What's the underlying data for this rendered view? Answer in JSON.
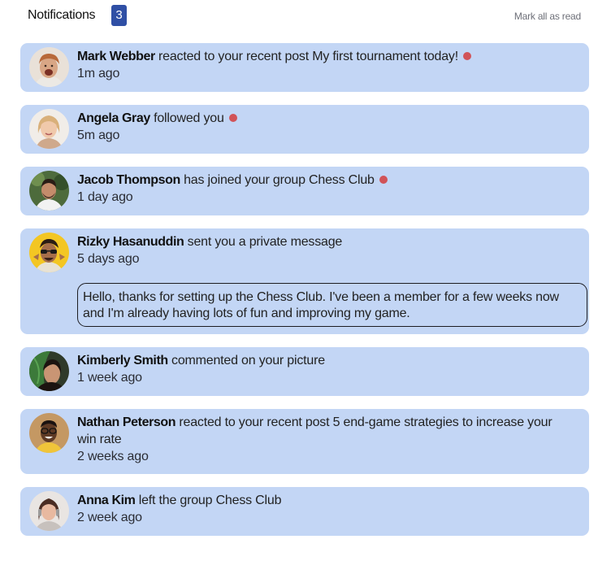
{
  "header": {
    "title": "Notifications",
    "count": "3",
    "mark_all": "Mark all as read"
  },
  "colors": {
    "card_background": "#c3d6f5",
    "unread_dot": "#d15358",
    "badge": "#2f4fa5"
  },
  "notifications": [
    {
      "name": "Mark Webber",
      "action": "reacted to your recent post My first tournament today!",
      "time": "1m ago",
      "unread": true
    },
    {
      "name": "Angela Gray",
      "action": "followed you",
      "time": "5m ago",
      "unread": true
    },
    {
      "name": "Jacob Thompson",
      "action": "has joined your group Chess Club",
      "time": "1 day ago",
      "unread": true
    },
    {
      "name": "Rizky Hasanuddin",
      "action": "sent you a private message",
      "time": "5 days ago",
      "unread": false,
      "message": "Hello, thanks for setting up the Chess Club. I've been a member for a few weeks now and I'm already having lots of fun and improving my game."
    },
    {
      "name": "Kimberly Smith",
      "action": "commented on your picture",
      "time": "1 week ago",
      "unread": false
    },
    {
      "name": "Nathan Peterson",
      "action": "reacted to your recent post 5 end-game strategies to increase your win rate",
      "time": "2 weeks ago",
      "unread": false
    },
    {
      "name": "Anna Kim",
      "action": "left the group Chess Club",
      "time": "2 week ago",
      "unread": false
    }
  ]
}
